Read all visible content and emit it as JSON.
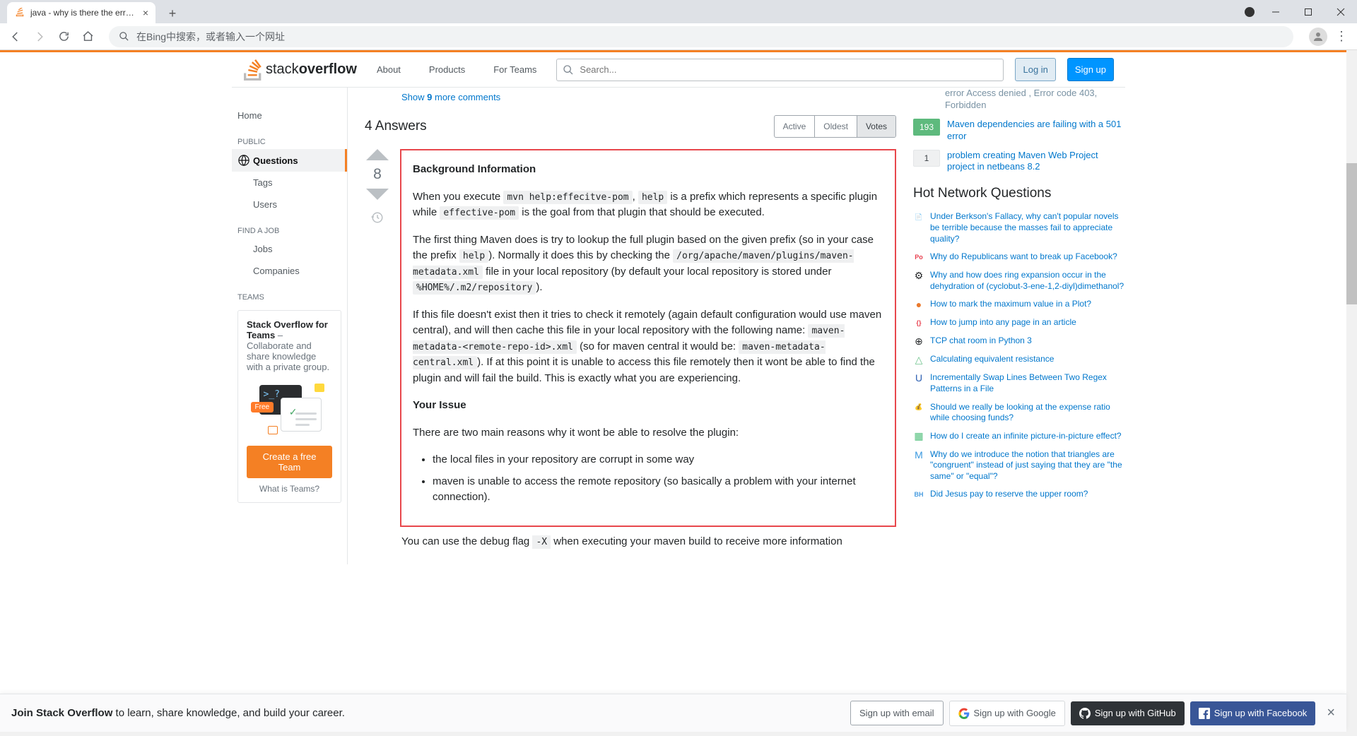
{
  "browser": {
    "tab_title": "java - why is there the error \"N",
    "omnibox_placeholder": "在Bing中搜索，或者输入一个网址"
  },
  "header": {
    "nav": {
      "about": "About",
      "products": "Products",
      "for_teams": "For Teams"
    },
    "search_placeholder": "Search...",
    "login": "Log in",
    "signup": "Sign up"
  },
  "sidebar": {
    "home": "Home",
    "public": "PUBLIC",
    "questions": "Questions",
    "tags": "Tags",
    "users": "Users",
    "find_job": "FIND A JOB",
    "jobs": "Jobs",
    "companies": "Companies",
    "teams_heading": "TEAMS",
    "teams_box_title": "Stack Overflow for Teams",
    "teams_box_text": " – Collaborate and share knowledge with a private group.",
    "free_badge": "Free",
    "create_team": "Create a free Team",
    "what_is_teams": "What is Teams?"
  },
  "related": [
    {
      "votes": "",
      "text": "error Access denied , Error code 403, Forbidden",
      "faded": true
    },
    {
      "votes": "193",
      "badge": "green",
      "text": "Maven dependencies are failing with a 501 error"
    },
    {
      "votes": "1",
      "badge": "gray",
      "text": "problem creating Maven Web Project project in netbeans 8.2"
    }
  ],
  "show_more": {
    "pre": "Show ",
    "count": "9",
    "post": " more comments"
  },
  "answers_heading": "4 Answers",
  "sort": {
    "active": "Active",
    "oldest": "Oldest",
    "votes": "Votes"
  },
  "answer": {
    "score": "8",
    "h1": "Background Information",
    "p1a": "When you execute ",
    "c1": "mvn help:effecitve-pom",
    "p1b": ", ",
    "c2": "help",
    "p1c": " is a prefix which represents a specific plugin while ",
    "c3": "effective-pom",
    "p1d": " is the goal from that plugin that should be executed.",
    "p2a": "The first thing Maven does is try to lookup the full plugin based on the given prefix (so in your case the prefix ",
    "c4": "help",
    "p2b": "). Normally it does this by checking the ",
    "c5": "/org/apache/maven/plugins/maven-metadata.xml",
    "p2c": " file in your local repository (by default your local repository is stored under ",
    "c6": "%HOME%/.m2/repository",
    "p2d": ").",
    "p3a": "If this file doesn't exist then it tries to check it remotely (again default configuration would use maven central), and will then cache this file in your local repository with the following name: ",
    "c7": "maven-metadata-<remote-repo-id>.xml",
    "p3b": " (so for maven central it would be: ",
    "c8": "maven-metadata-central.xml",
    "p3c": "). If at this point it is unable to access this file remotely then it wont be able to find the plugin and will fail the build. This is exactly what you are experiencing.",
    "h2": "Your Issue",
    "p4": "There are two main reasons why it wont be able to resolve the plugin:",
    "li1": "the local files in your repository are corrupt in some way",
    "li2": "maven is unable to access the remote repository (so basically a problem with your internet connection).",
    "after_a": "You can use the debug flag ",
    "after_code": "-X",
    "after_b": " when executing your maven build to receive more information"
  },
  "hot_title": "Hot Network Questions",
  "hot": [
    {
      "icon": "📄",
      "text": "Under Berkson's Fallacy, why can't popular novels be terrible because the masses fail to appreciate quality?"
    },
    {
      "icon": "Po",
      "color": "#e84150",
      "text": "Why do Republicans want to break up Facebook?"
    },
    {
      "icon": "⚙",
      "text": "Why and how does ring expansion occur in the dehydration of (cyclobut-3-ene-1,2-diyl)dimethanol?"
    },
    {
      "icon": "●",
      "color": "#ea7a2d",
      "text": "How to mark the maximum value in a Plot?"
    },
    {
      "icon": "{}",
      "color": "#e84150",
      "text": "How to jump into any page in an article"
    },
    {
      "icon": "⊕",
      "text": "TCP chat room in Python 3"
    },
    {
      "icon": "△",
      "color": "#6fc38d",
      "text": "Calculating equivalent resistance"
    },
    {
      "icon": "U",
      "color": "#2c5fb2",
      "text": "Incrementally Swap Lines Between Two Regex Patterns in a File"
    },
    {
      "icon": "💰",
      "text": "Should we really be looking at the expense ratio while choosing funds?"
    },
    {
      "icon": "▦",
      "color": "#4fbf7a",
      "text": "How do I create an infinite picture-in-picture effect?"
    },
    {
      "icon": "M",
      "color": "#3b99e0",
      "text": "Why do we introduce the notion that triangles are \"congruent\" instead of just saying that they are \"the same\" or \"equal\"?"
    },
    {
      "icon": "BH",
      "color": "#4a9de0",
      "text": "Did Jesus pay to reserve the upper room?"
    }
  ],
  "banner": {
    "bold": "Join Stack Overflow",
    "rest": " to learn, share knowledge, and build your career.",
    "email": "Sign up with email",
    "google": "Sign up with Google",
    "github": "Sign up with GitHub",
    "facebook": "Sign up with Facebook"
  }
}
